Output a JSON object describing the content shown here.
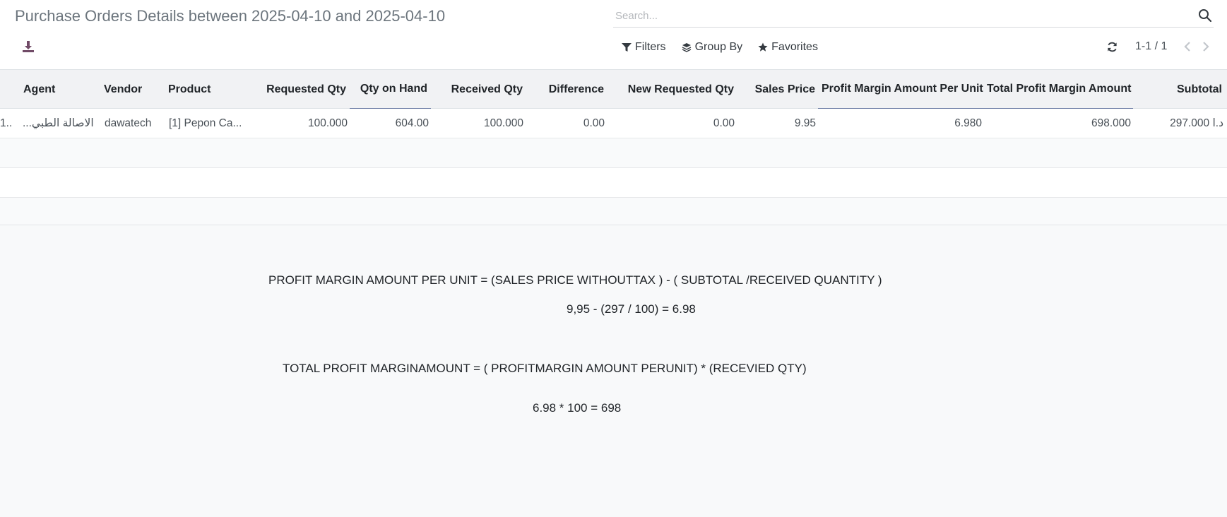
{
  "header": {
    "title": "Purchase Orders Details between 2025-04-10 and 2025-04-10",
    "search_placeholder": "Search..."
  },
  "toolbar": {
    "filters_label": "Filters",
    "group_by_label": "Group By",
    "favorites_label": "Favorites",
    "pager_value": "1-1 / 1"
  },
  "table": {
    "columns": [
      "Agent",
      "Vendor",
      "Product",
      "Requested Qty",
      "Qty on Hand",
      "Received Qty",
      "Difference",
      "New Requested Qty",
      "Sales Price",
      "Profit Margin Amount Per Unit",
      "Total Profit Margin Amount",
      "Subtotal"
    ],
    "rows": [
      {
        "ref": "1...",
        "agent": "...الاصالة الطبي",
        "vendor": "dawatech",
        "product": "[1] Pepon Ca...",
        "requested_qty": "100.000",
        "qty_on_hand": "604.00",
        "received_qty": "100.000",
        "difference": "0.00",
        "new_requested_qty": "0.00",
        "sales_price": "9.95",
        "profit_margin_per_unit": "6.980",
        "total_profit_margin": "698.000",
        "subtotal": "297.000 د.ا"
      }
    ]
  },
  "notes": {
    "formula_1": "PROFIT MARGIN AMOUNT PER UNIT = (SALES PRICE WITHOUTTAX ) - ( SUBTOTAL /RECEIVED QUANTITY )",
    "calc_1": "9,95 - (297 / 100) = 6.98",
    "formula_2": "TOTAL PROFIT MARGINAMOUNT = ( PROFITMARGIN AMOUNT PERUNIT) * (RECEVIED QTY)",
    "calc_2": "6.98 * 100 = 698"
  },
  "colors": {
    "accent": "#714b67",
    "sorted_underline": "#6f7ea6"
  }
}
